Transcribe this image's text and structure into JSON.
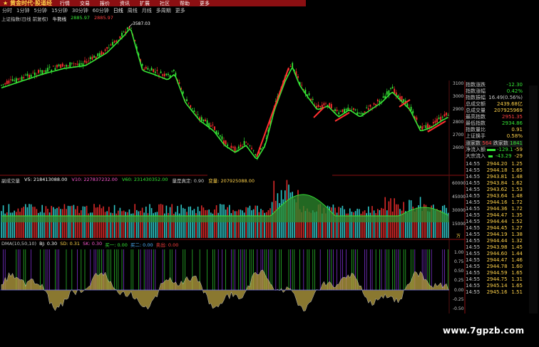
{
  "menubar": {
    "logo": "★ 黄金时代·股道经",
    "items": [
      "行情",
      "交易",
      "报价",
      "资讯",
      "扩展",
      "社区",
      "帮助",
      "更多"
    ]
  },
  "periods": [
    "分时",
    "1分钟",
    "5分钟",
    "15分钟",
    "30分钟",
    "60分钟",
    "日线",
    "周线",
    "月线",
    "多周期",
    "更多"
  ],
  "active_period": "日线",
  "main_panel": {
    "title": "上证指数(日线 前复权)",
    "indicator": "牛熊线",
    "values": [
      "2885.97",
      "2885.97"
    ],
    "peak_label": "3587.03",
    "price_axis": [
      "3100",
      "3000",
      "2900",
      "2800",
      "2700",
      "2600"
    ]
  },
  "volume_panel": {
    "title": "副成交量",
    "items": [
      {
        "label": "V5: 218413088.00",
        "color": "#ffffff"
      },
      {
        "label": "V10: 227837232.00",
        "color": "#ff5ad2"
      },
      {
        "label": "V60: 231430352.00",
        "color": "#36e836"
      },
      {
        "label": "量是真定: 0.90",
        "color": "#c8c8c8"
      },
      {
        "label": "变量: 207925088.00",
        "color": "#ffd24a"
      }
    ],
    "axis": [
      "60000",
      "45000",
      "30000",
      "15000"
    ],
    "unit": "万"
  },
  "dma_panel": {
    "items": [
      {
        "label": "DMA(10,50,10)",
        "color": "#c8c8c8"
      },
      {
        "label": "BJ: 0.30",
        "color": "#ffffff"
      },
      {
        "label": "SD: 0.31",
        "color": "#ffd24a"
      },
      {
        "label": "SK: 0.30",
        "color": "#ff5ad2"
      },
      {
        "label": "买一: 0.00",
        "color": "#36e836"
      },
      {
        "label": "买二: 0.00",
        "color": "#4fb4ff"
      },
      {
        "label": "卖出: 0.00",
        "color": "#ff4040"
      }
    ],
    "axis": [
      "1.00",
      "0.75",
      "0.50",
      "0.25",
      "0.00",
      "-0.25",
      "-0.50"
    ]
  },
  "right_panel": {
    "stats": [
      {
        "label": "指数涨跌",
        "value": "-12.30",
        "color": "#36e836"
      },
      {
        "label": "指数涨幅",
        "value": "0.42%",
        "color": "#36e836"
      },
      {
        "label": "指数振幅",
        "value": "16.49(0.56%)",
        "color": "#c8c8c8"
      },
      {
        "label": "总成交额",
        "value": "2439.68亿",
        "color": "#ffd24a"
      },
      {
        "label": "总成交量",
        "value": "207925969",
        "color": "#ffd24a"
      },
      {
        "label": "最高指数",
        "value": "2951.35",
        "color": "#ff4040"
      },
      {
        "label": "最低指数",
        "value": "2934.86",
        "color": "#36e836"
      },
      {
        "label": "指数量比",
        "value": "0.91",
        "color": "#ffd24a"
      },
      {
        "label": "上证换手",
        "value": "0.58%",
        "color": "#ffd24a"
      }
    ],
    "updown": {
      "up_label": "涨家数",
      "up": "564",
      "down_label": "跌家数",
      "down": "1841"
    },
    "flows": [
      {
        "label": "净流入额",
        "value": "-129.1",
        "extra": "-59"
      },
      {
        "label": "大宗流入",
        "value": "-43.29",
        "extra": "-29"
      }
    ],
    "ticks": [
      {
        "t": "14:55",
        "p": "2944.20",
        "v": "1.25"
      },
      {
        "t": "14:55",
        "p": "2944.18",
        "v": "1.65"
      },
      {
        "t": "14:55",
        "p": "2943.81",
        "v": "1.48"
      },
      {
        "t": "14:55",
        "p": "2943.84",
        "v": "1.62"
      },
      {
        "t": "14:55",
        "p": "2943.62",
        "v": "1.53"
      },
      {
        "t": "14:55",
        "p": "2943.64",
        "v": "1.48"
      },
      {
        "t": "14:55",
        "p": "2944.16",
        "v": "1.72"
      },
      {
        "t": "14:55",
        "p": "2944.36",
        "v": "1.72"
      },
      {
        "t": "14:55",
        "p": "2944.47",
        "v": "1.35"
      },
      {
        "t": "14:55",
        "p": "2944.44",
        "v": "1.52"
      },
      {
        "t": "14:55",
        "p": "2944.45",
        "v": "1.27"
      },
      {
        "t": "14:55",
        "p": "2944.19",
        "v": "1.38"
      },
      {
        "t": "14:55",
        "p": "2944.44",
        "v": "1.32"
      },
      {
        "t": "14:55",
        "p": "2943.98",
        "v": "1.45"
      },
      {
        "t": "14:55",
        "p": "2944.60",
        "v": "1.44"
      },
      {
        "t": "14:55",
        "p": "2944.47",
        "v": "1.46"
      },
      {
        "t": "14:55",
        "p": "2944.78",
        "v": "1.60"
      },
      {
        "t": "14:55",
        "p": "2944.59",
        "v": "1.65"
      },
      {
        "t": "14:55",
        "p": "2944.75",
        "v": "1.31"
      },
      {
        "t": "14:55",
        "p": "2945.14",
        "v": "1.65"
      },
      {
        "t": "14:55",
        "p": "2945.16",
        "v": "1.51"
      }
    ]
  },
  "watermark": "www.7gpzb.com",
  "colors": {
    "up": "#ff3030",
    "down": "#36e836",
    "accent": "#ffd24a"
  }
}
